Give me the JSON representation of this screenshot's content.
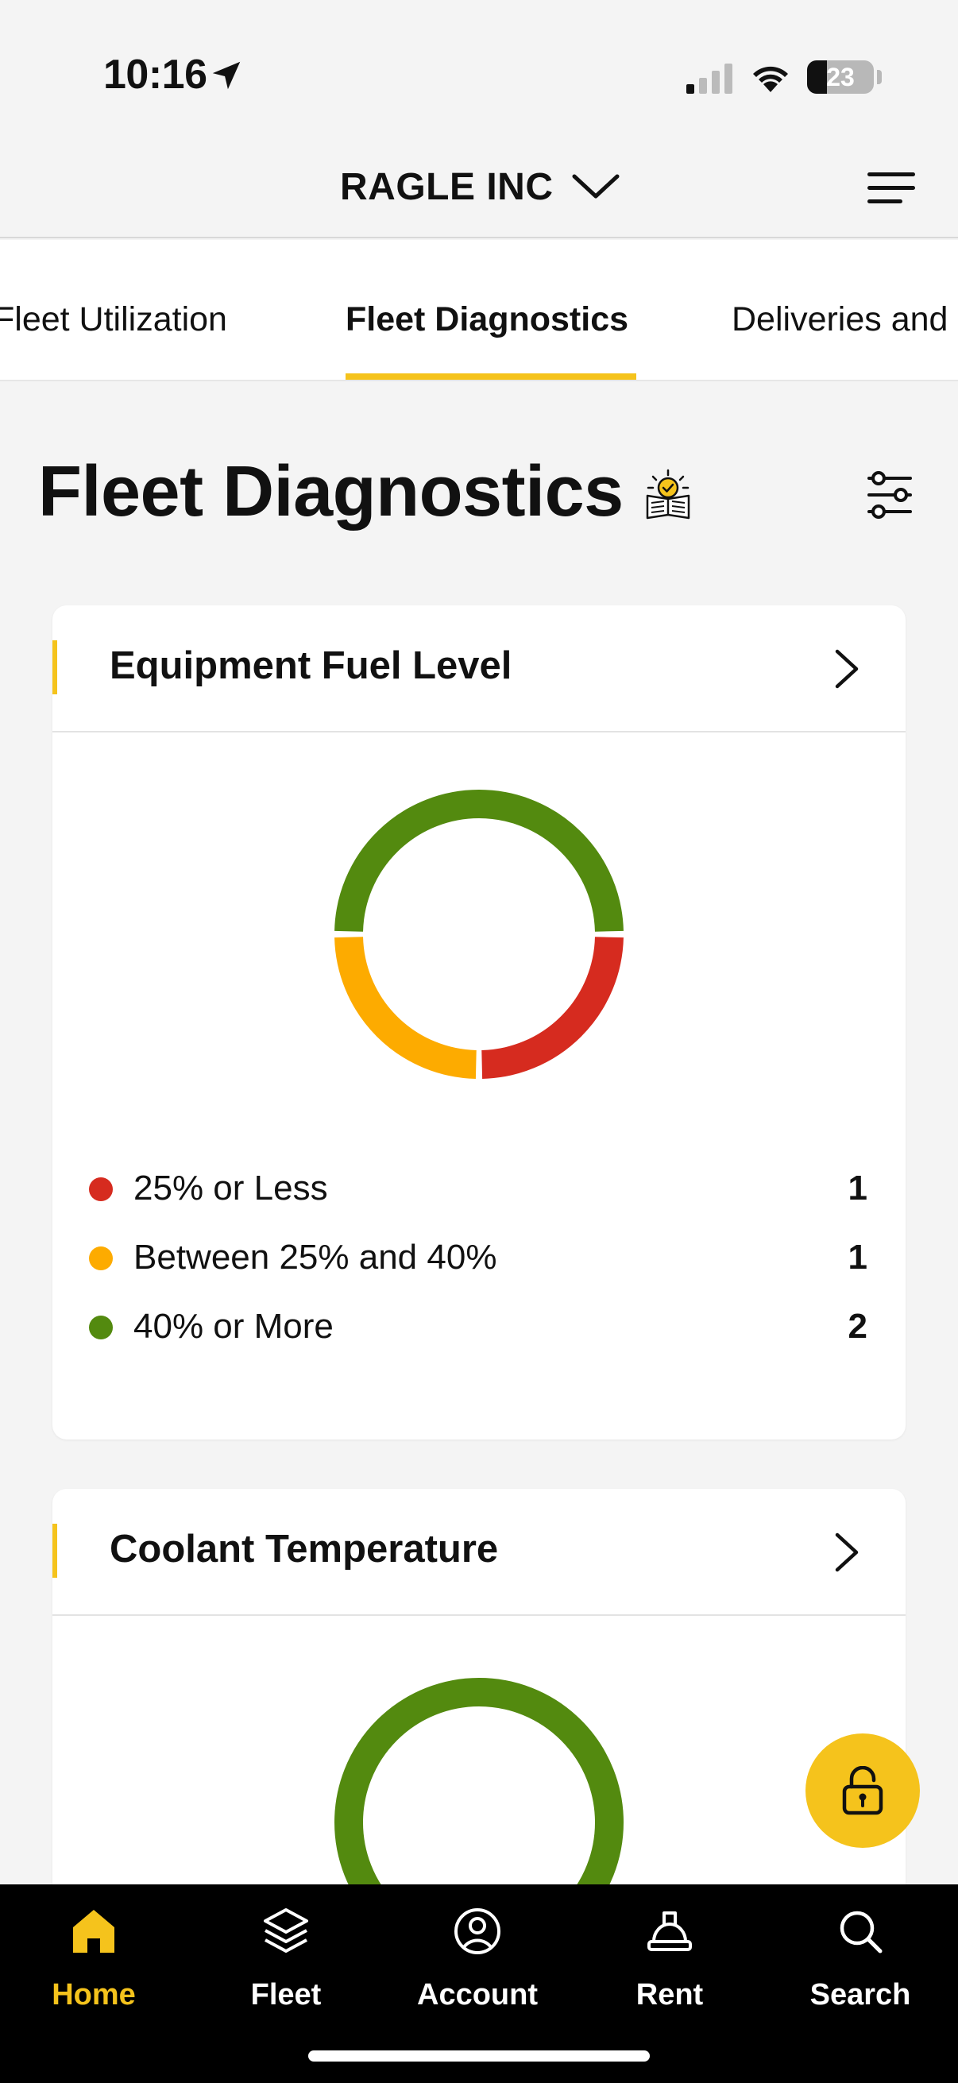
{
  "status_bar": {
    "time": "10:16",
    "battery": "23"
  },
  "header": {
    "account_name": "RAGLE INC"
  },
  "tabs": [
    {
      "label": "Fleet Utilization",
      "active": false
    },
    {
      "label": "Fleet Diagnostics",
      "active": true
    },
    {
      "label": "Deliveries and Returns",
      "active": false
    }
  ],
  "page": {
    "title": "Fleet Diagnostics"
  },
  "cards": [
    {
      "title": "Equipment Fuel Level",
      "chart_data": {
        "type": "pie",
        "donut": true,
        "categories": [
          "25% or Less",
          "Between 25% and 40%",
          "40% or More"
        ],
        "values": [
          1,
          1,
          2
        ],
        "colors": [
          "#d62b1f",
          "#fdab00",
          "#538a0f"
        ]
      },
      "legend": [
        {
          "label": "25% or Less",
          "count": "1",
          "color": "#d62b1f"
        },
        {
          "label": "Between 25% and 40%",
          "count": "1",
          "color": "#fdab00"
        },
        {
          "label": "40% or More",
          "count": "2",
          "color": "#538a0f"
        }
      ]
    },
    {
      "title": "Coolant Temperature",
      "chart_data": {
        "type": "pie",
        "donut": true,
        "values": [
          1
        ],
        "colors": [
          "#538a0f"
        ]
      }
    }
  ],
  "bottom_nav": [
    {
      "label": "Home",
      "icon": "home-icon",
      "active": true
    },
    {
      "label": "Fleet",
      "icon": "layers-icon",
      "active": false
    },
    {
      "label": "Account",
      "icon": "account-icon",
      "active": false
    },
    {
      "label": "Rent",
      "icon": "hardhat-icon",
      "active": false
    },
    {
      "label": "Search",
      "icon": "search-icon",
      "active": false
    }
  ],
  "colors": {
    "accent": "#f5c31c",
    "nav_background": "#000000",
    "red": "#d62b1f",
    "orange": "#fdab00",
    "green": "#538a0f"
  }
}
